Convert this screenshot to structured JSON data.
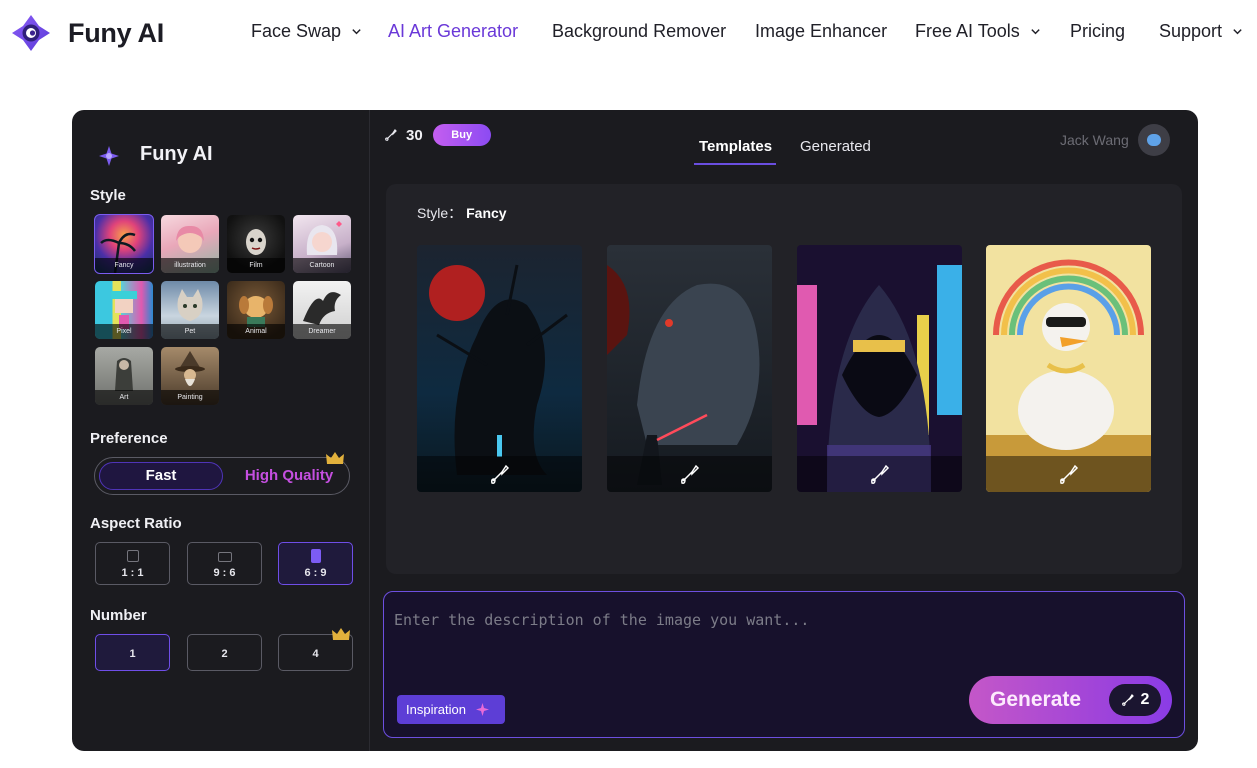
{
  "brand": {
    "name": "Funy AI"
  },
  "nav": [
    {
      "label": "Face Swap",
      "dropdown": true,
      "active": false
    },
    {
      "label": "AI Art Generator",
      "dropdown": false,
      "active": true
    },
    {
      "label": "Background Remover",
      "dropdown": false,
      "active": false
    },
    {
      "label": "Image Enhancer",
      "dropdown": false,
      "active": false
    },
    {
      "label": "Free AI Tools",
      "dropdown": true,
      "active": false
    },
    {
      "label": "Pricing",
      "dropdown": false,
      "active": false
    },
    {
      "label": "Support",
      "dropdown": true,
      "active": false
    }
  ],
  "sidebar": {
    "title": "Funy AI",
    "style_label": "Style",
    "styles": [
      "Fancy",
      "illustration",
      "Film",
      "Cartoon",
      "Pixel",
      "Pet",
      "Animal",
      "Dreamer",
      "Art",
      "Painting"
    ],
    "selected_style": "Fancy",
    "preference_label": "Preference",
    "preference": {
      "fast": "Fast",
      "high_quality": "High Quality",
      "selected": "Fast"
    },
    "aspect_label": "Aspect Ratio",
    "aspect_ratios": [
      "1 : 1",
      "9 : 6",
      "6 : 9"
    ],
    "selected_aspect": "6 : 9",
    "number_label": "Number",
    "numbers": [
      "1",
      "2",
      "4"
    ],
    "selected_number": "1"
  },
  "header": {
    "credits": "30",
    "buy_label": "Buy",
    "tabs": [
      "Templates",
      "Generated"
    ],
    "active_tab": "Templates",
    "user_name": "Jack Wang"
  },
  "gallery": {
    "style_prefix": "Style：",
    "style_value": "Fancy"
  },
  "prompt": {
    "placeholder": "Enter the description of the image you want...",
    "inspiration_label": "Inspiration",
    "generate_label": "Generate",
    "generate_cost": "2"
  },
  "colors": {
    "accent": "#6a38d8",
    "panel": "#1b1b1f",
    "pink": "#c54fe0"
  }
}
